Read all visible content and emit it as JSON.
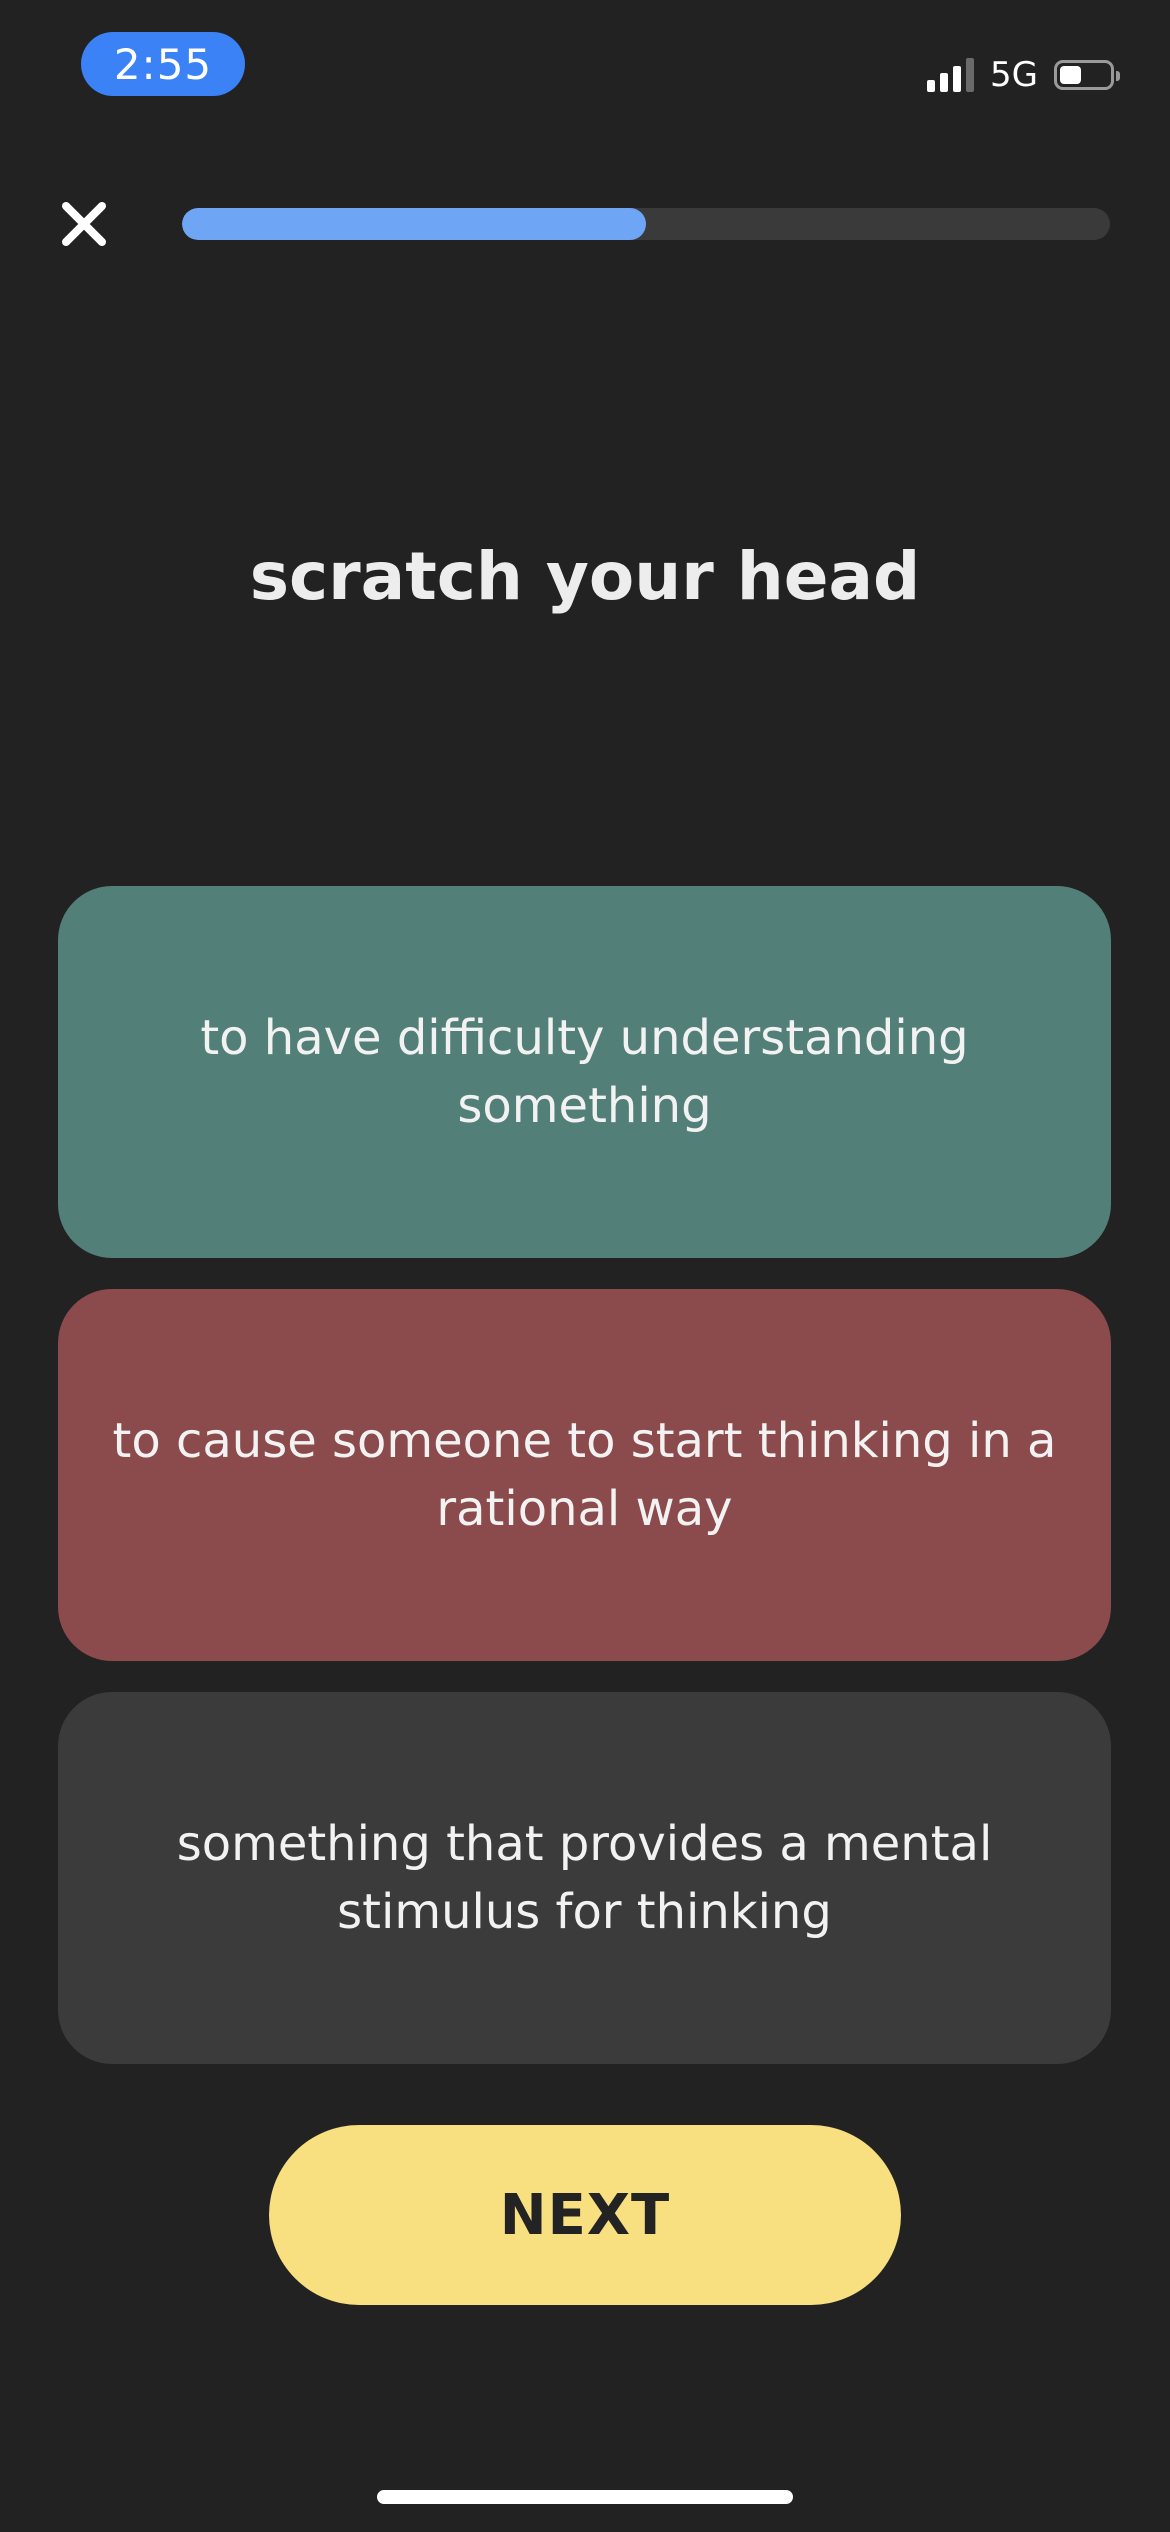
{
  "status_bar": {
    "time": "2:55",
    "network": "5G",
    "signal_bars": 3,
    "signal_total": 4,
    "battery_level": 0.45
  },
  "top_bar": {
    "close_icon": "close-icon",
    "progress": 0.5
  },
  "quiz": {
    "prompt": "scratch your head",
    "answers": [
      {
        "text": "to have difficulty understanding something",
        "state": "correct",
        "color": "#527f77"
      },
      {
        "text": "to cause someone to start thinking in a rational way",
        "state": "incorrect",
        "color": "#8b4a4b"
      },
      {
        "text": "something that provides a mental stimulus for thinking",
        "state": "neutral",
        "color": "#3b3b3b"
      }
    ]
  },
  "actions": {
    "next_label": "NEXT",
    "next_color": "#f8df80"
  },
  "colors": {
    "background": "#222222",
    "accent": "#3b82f6",
    "progress_fill": "#6ea5f5"
  }
}
